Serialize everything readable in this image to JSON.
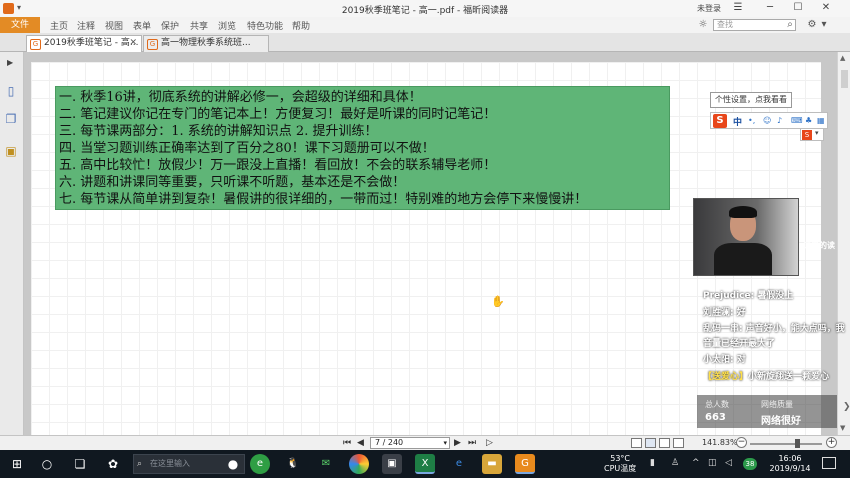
{
  "window": {
    "title": "2019秋季班笔记 - 高一.pdf - 福昕阅读器",
    "login_label": "未登录",
    "min_icon": "minimize-icon",
    "max_icon": "maximize-icon",
    "close_icon": "close-icon"
  },
  "menu": {
    "file_label": "文件",
    "items": [
      "主页",
      "注释",
      "视图",
      "表单",
      "保护",
      "共享",
      "浏览",
      "特色功能",
      "帮助"
    ],
    "search_placeholder": "查找"
  },
  "tabs": [
    {
      "label": "2019秋季班笔记 - 高...",
      "active": true
    },
    {
      "label": "高一物理秋季系统班...",
      "active": false
    }
  ],
  "document": {
    "notes": [
      "一. 秋季16讲，彻底系统的讲解必修一，会超级的详细和具体！",
      "二. 笔记建议你记在专门的笔记本上！方便复习！最好是听课的同时记笔记！",
      "三. 每节课两部分：1. 系统的讲解知识点 2. 提升训练！",
      "四. 当堂习题训练正确率达到了百分之80！课下习题册可以不做！",
      "五. 高中比较忙！放假少！万一跟没上直播！看回放！不会的联系辅导老师！",
      "六. 讲题和讲课同等重要，只听课不听题，基本还是不会做！",
      "七. 每节课从简单讲到复杂！暑假讲的很详细的，一带而过！特别难的地方会停下来慢慢讲！"
    ],
    "note_box_color": "#5fb577"
  },
  "ime": {
    "tooltip": "个性设置，点我看看",
    "lang_label": "中"
  },
  "live": {
    "chat_cut": "过来的读",
    "messages": [
      {
        "name": "Prejudice:",
        "text": "暑假没上"
      },
      {
        "name": "刘胜澜:",
        "text": "好"
      },
      {
        "name": "乱码一串:",
        "text": "声音好小，能大点吗，我"
      },
      {
        "name": "",
        "text": "音量已经开最大了"
      },
      {
        "name": "小太阳:",
        "text": "对"
      }
    ],
    "gift": {
      "tag": "【送爱心】",
      "text": "小新旋翔送一颗爱心"
    },
    "stats": {
      "people_label": "总人数",
      "people_value": "663",
      "quality_label": "网络质量",
      "quality_value": "网络很好"
    }
  },
  "status": {
    "page_input": "7 / 240",
    "zoom": "141.83%",
    "zoom_fraction": 0.65
  },
  "taskbar": {
    "search_placeholder": "在这里输入",
    "temperature": "53°C",
    "cpu_label": "CPU温度",
    "badge": "38",
    "time": "16:06",
    "date": "2019/9/14"
  }
}
